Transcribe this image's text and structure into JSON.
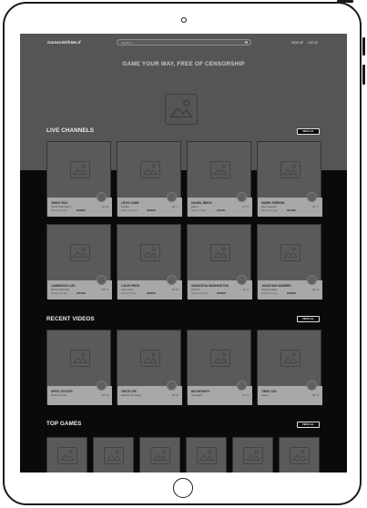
{
  "nav": {
    "logo": "GamesWithMe.tf",
    "search_placeholder": "SEARCH",
    "login": "SIGN UP",
    "signup": "LOG IN"
  },
  "hero": {
    "title": "GAME YOUR WAY, FREE OF CENSORSHIP"
  },
  "live": {
    "title": "LIVE CHANNELS",
    "view_all": "VIEW ALL",
    "cards": [
      {
        "name": "JENNY ROX",
        "game": "Grand Theft Auto V",
        "stat": "16 / 8",
        "meta": "Started 3 hrs ago",
        "tag": "RANKED"
      },
      {
        "name": "LEVIS GAME",
        "game": "Fortnite",
        "stat": "23 / 7",
        "meta": "Started 2 hrs ago",
        "tag": "RANKED"
      },
      {
        "name": "DANIEL BRICK",
        "game": "Halo 3",
        "stat": "12 / 5",
        "meta": "Started 1 hr ago",
        "tag": "CASUAL"
      },
      {
        "name": "MARIE ZIEBEEM",
        "game": "Apex Legends",
        "stat": "31 / 7",
        "meta": "Started 4 hrs ago",
        "tag": "ARCADE"
      },
      {
        "name": "LAWRENCE LUIS",
        "game": "World of Warcraft",
        "stat": "18 / 6",
        "meta": "Started 2 hrs ago",
        "tag": "ARCADE"
      },
      {
        "name": "LOUIS PRICE",
        "game": "Call of Duty",
        "stat": "14 / 6",
        "meta": "Started 1 hr ago",
        "tag": "RANKED"
      },
      {
        "name": "SAMANTHA WASHINGTON",
        "game": "FIFA 19",
        "stat": "11 / 2",
        "meta": "Started 3 hrs ago",
        "tag": "RANKED"
      },
      {
        "name": "JONATHAN WARREN",
        "game": "Rocket League",
        "stat": "22 / 8",
        "meta": "Started 5 hrs ago",
        "tag": "RANKED"
      }
    ]
  },
  "recent": {
    "title": "RECENT VIDEOS",
    "view_all": "VIEW ALL",
    "cards": [
      {
        "name": "APRIL STOCKS",
        "game": "World of Tanks",
        "stat": "16 / 8"
      },
      {
        "name": "VINCE LEE",
        "game": "Rainbow Six Siege",
        "stat": "23 / 8"
      },
      {
        "name": "BIG MONKEY",
        "game": "Overwatch",
        "stat": "14 / 3"
      },
      {
        "name": "TINNY JAD",
        "game": "Dota 2",
        "stat": "25 / 8"
      }
    ]
  },
  "top": {
    "title": "TOP GAMES",
    "view_all": "VIEW ALL"
  }
}
